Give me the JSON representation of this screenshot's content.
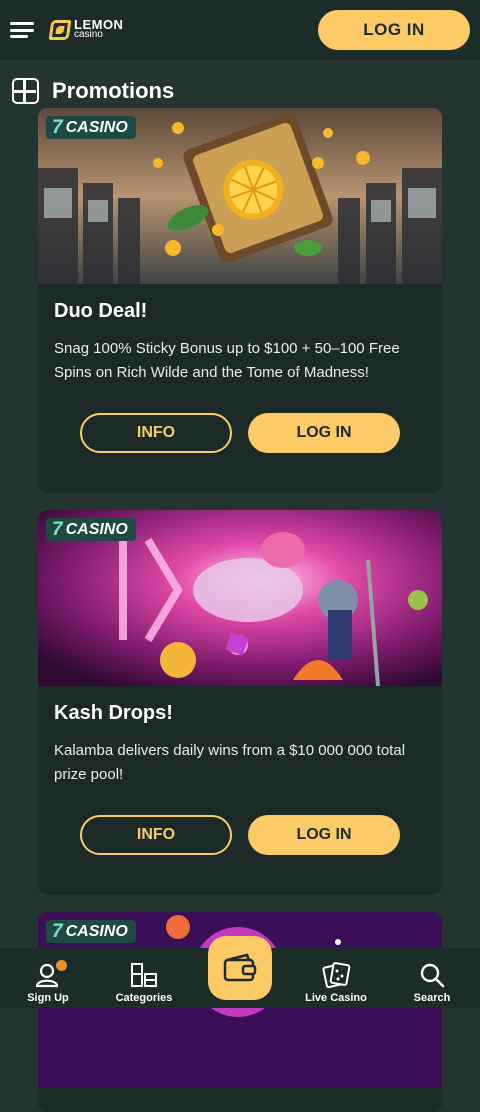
{
  "header": {
    "logo_line1": "LEMON",
    "logo_line2": "casino",
    "login_label": "LOG IN"
  },
  "section": {
    "title": "Promotions"
  },
  "promotions": [
    {
      "badge": "CASINO",
      "title": "Duo Deal!",
      "description": "Snag 100% Sticky Bonus up to $100 + 50–100 Free Spins on Rich Wilde and the Tome of Madness!",
      "info_label": "INFO",
      "login_label": "LOG IN"
    },
    {
      "badge": "CASINO",
      "title": "Kash Drops!",
      "description": "Kalamba delivers daily wins from a $10 000 000 total prize pool!",
      "info_label": "INFO",
      "login_label": "LOG IN"
    },
    {
      "badge": "CASINO"
    }
  ],
  "bottom_nav": {
    "signup": "Sign Up",
    "categories": "Categories",
    "live_casino": "Live Casino",
    "search": "Search"
  },
  "colors": {
    "accent": "#fccb66",
    "background": "#243531",
    "header": "#1c2c29",
    "card": "#1c2a27",
    "badge": "#1f4a43",
    "notification_dot": "#f28c28"
  },
  "icons": {
    "menu": "hamburger-icon",
    "section": "promotions-icon",
    "badge": "seven-icon",
    "signup": "user-icon",
    "categories": "grid-icon",
    "wallet": "wallet-icon",
    "live_casino": "cards-icon",
    "search": "search-icon"
  }
}
